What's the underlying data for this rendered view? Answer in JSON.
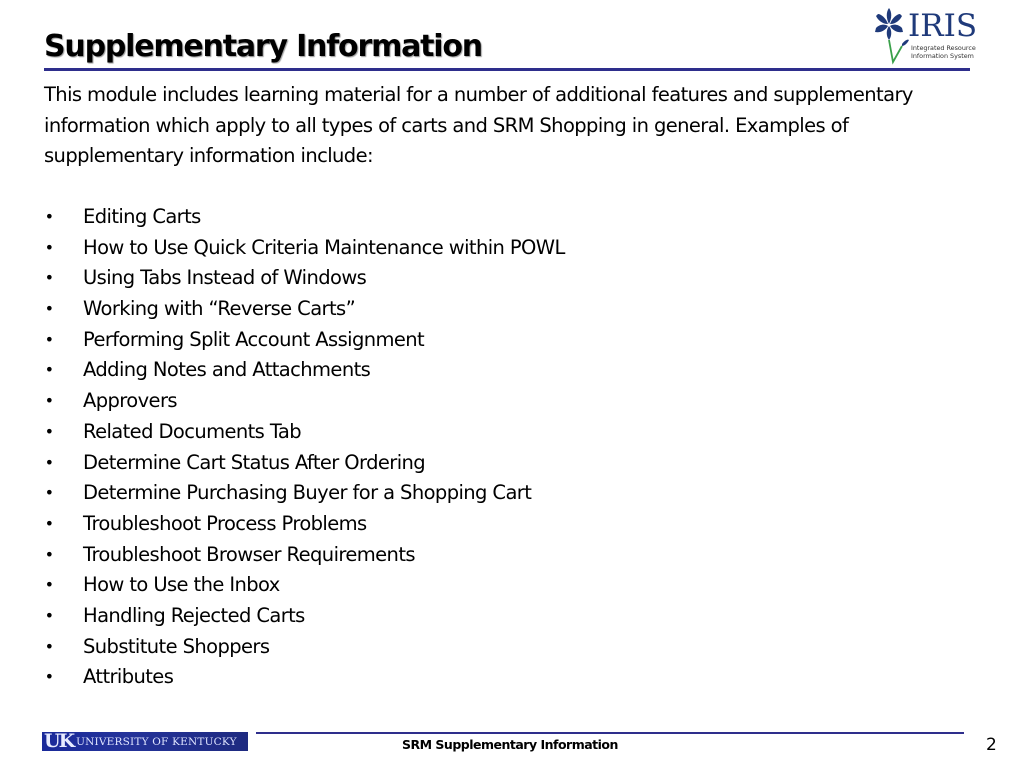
{
  "header": {
    "title": "Supplementary Information",
    "logo": {
      "name": "IRIS",
      "tagline_line1": "Integrated Resource",
      "tagline_line2": "Information System",
      "icon": "iris-flower-icon",
      "brand_color": "#1f3a7a",
      "stem_color": "#3aa04a"
    }
  },
  "body": {
    "intro": "This module includes learning material for a number of additional features and supplementary information which apply to all types of carts and SRM Shopping in general. Examples of supplementary information include:",
    "bullet_glyph": "•",
    "items": [
      "Editing Carts",
      "How to Use Quick Criteria Maintenance within POWL",
      "Using Tabs Instead of Windows",
      "Working with “Reverse Carts”",
      "Performing Split Account Assignment",
      "Adding Notes and Attachments",
      "Approvers",
      "Related Documents Tab",
      "Determine Cart Status After Ordering",
      "Determine Purchasing Buyer for a Shopping Cart",
      "Troubleshoot Process Problems",
      "Troubleshoot Browser Requirements",
      "How to Use the Inbox",
      "Handling Rejected Carts",
      "Substitute Shoppers",
      "Attributes"
    ]
  },
  "footer": {
    "university_logo_mark": "UK",
    "university_logo_name": "UNIVERSITY OF KENTUCKY",
    "text": "SRM Supplementary Information",
    "page_number": "2",
    "rule_color": "#2e2e8c"
  }
}
